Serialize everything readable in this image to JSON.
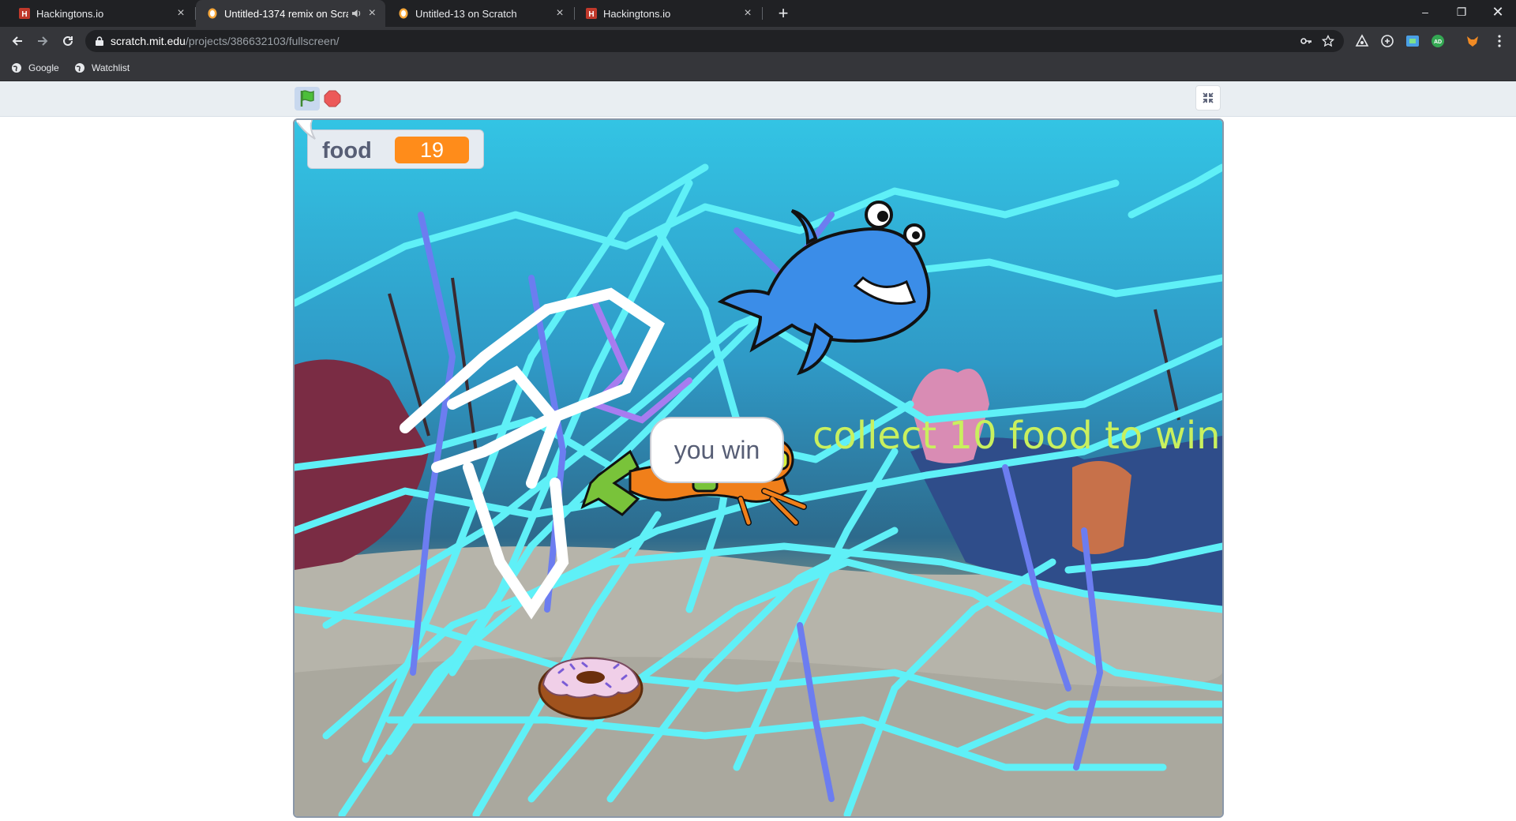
{
  "browser": {
    "tabs": [
      {
        "title": "Hackingtons.io",
        "favicon": "hackingtons-icon",
        "active": false
      },
      {
        "title": "Untitled-1374 remix on Scrat",
        "favicon": "scratch-icon",
        "active": true,
        "audio": true
      },
      {
        "title": "Untitled-13 on Scratch",
        "favicon": "scratch-icon",
        "active": false
      },
      {
        "title": "Hackingtons.io",
        "favicon": "hackingtons-icon",
        "active": false
      }
    ],
    "address": {
      "host": "scratch.mit.edu",
      "path": "/projects/386632103/fullscreen/"
    },
    "bookmarks": [
      {
        "label": "Google",
        "icon": "globe-icon"
      },
      {
        "label": "Watchlist",
        "icon": "globe-icon"
      }
    ]
  },
  "stage": {
    "monitor": {
      "label": "food",
      "value": "19"
    },
    "speech": "you win",
    "message": "collect 10 food to win"
  },
  "colors": {
    "tabstrip": "#202124",
    "toolbar": "#35363a",
    "monitor_value": "#ff8c1a",
    "pen_cyan": "#5ff0f7",
    "message_text": "#c9f05e",
    "shark": "#3b8de8"
  }
}
